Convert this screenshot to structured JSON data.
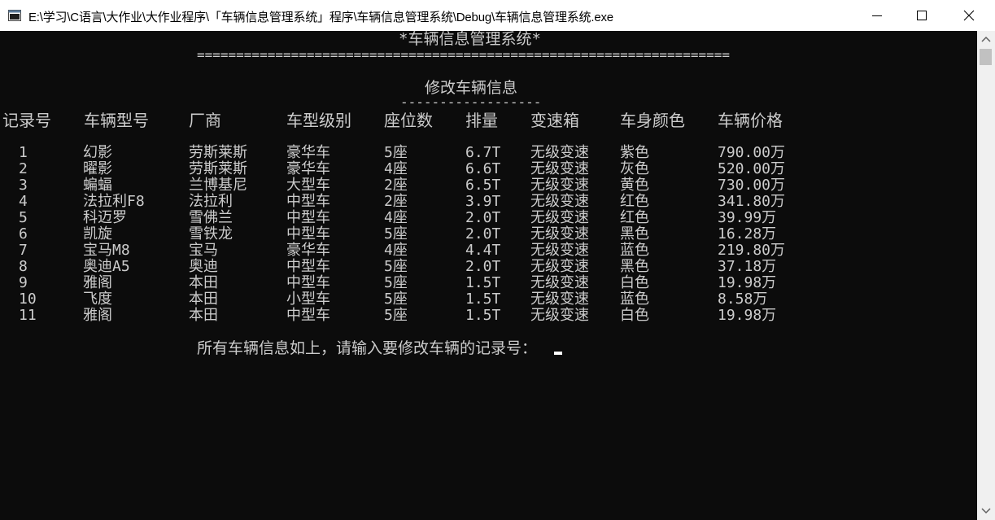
{
  "window": {
    "title": "E:\\学习\\C语言\\大作业\\大作业程序\\「车辆信息管理系统」程序\\车辆信息管理系统\\Debug\\车辆信息管理系统.exe",
    "icons": {
      "app": "console-app-icon",
      "minimize": "minimize-icon",
      "maximize": "maximize-icon",
      "close": "close-icon"
    }
  },
  "console": {
    "app_title": "*车辆信息管理系统*",
    "separator": "====================================================================",
    "section_title": "修改车辆信息",
    "section_underline": "------------------",
    "columns": [
      "记录号",
      "车辆型号",
      "厂商",
      "车型级别",
      "座位数",
      "排量",
      "变速箱",
      "车身颜色",
      "车辆价格"
    ],
    "rows": [
      [
        "1",
        "幻影",
        "劳斯莱斯",
        "豪华车",
        "5座",
        "6.7T",
        "无级变速",
        "紫色",
        "790.00万"
      ],
      [
        "2",
        "曜影",
        "劳斯莱斯",
        "豪华车",
        "4座",
        "6.6T",
        "无级变速",
        "灰色",
        "520.00万"
      ],
      [
        "3",
        "蝙蝠",
        "兰博基尼",
        "大型车",
        "2座",
        "6.5T",
        "无级变速",
        "黄色",
        "730.00万"
      ],
      [
        "4",
        "法拉利F8",
        "法拉利",
        "中型车",
        "2座",
        "3.9T",
        "无级变速",
        "红色",
        "341.80万"
      ],
      [
        "5",
        "科迈罗",
        "雪佛兰",
        "中型车",
        "4座",
        "2.0T",
        "无级变速",
        "红色",
        "39.99万"
      ],
      [
        "6",
        "凯旋",
        "雪铁龙",
        "中型车",
        "5座",
        "2.0T",
        "无级变速",
        "黑色",
        "16.28万"
      ],
      [
        "7",
        "宝马M8",
        "宝马",
        "豪华车",
        "4座",
        "4.4T",
        "无级变速",
        "蓝色",
        "219.80万"
      ],
      [
        "8",
        "奥迪A5",
        "奥迪",
        "中型车",
        "5座",
        "2.0T",
        "无级变速",
        "黑色",
        "37.18万"
      ],
      [
        "9",
        "雅阁",
        "本田",
        "中型车",
        "5座",
        "1.5T",
        "无级变速",
        "白色",
        "19.98万"
      ],
      [
        "10",
        "飞度",
        "本田",
        "小型车",
        "5座",
        "1.5T",
        "无级变速",
        "蓝色",
        "8.58万"
      ],
      [
        "11",
        "雅阁",
        "本田",
        "中型车",
        "5座",
        "1.5T",
        "无级变速",
        "白色",
        "19.98万"
      ]
    ],
    "prompt": "所有车辆信息如上，请输入要修改车辆的记录号："
  },
  "colors": {
    "console_bg": "#0c0c0c",
    "console_text": "#cccccc",
    "titlebar_bg": "#ffffff"
  }
}
